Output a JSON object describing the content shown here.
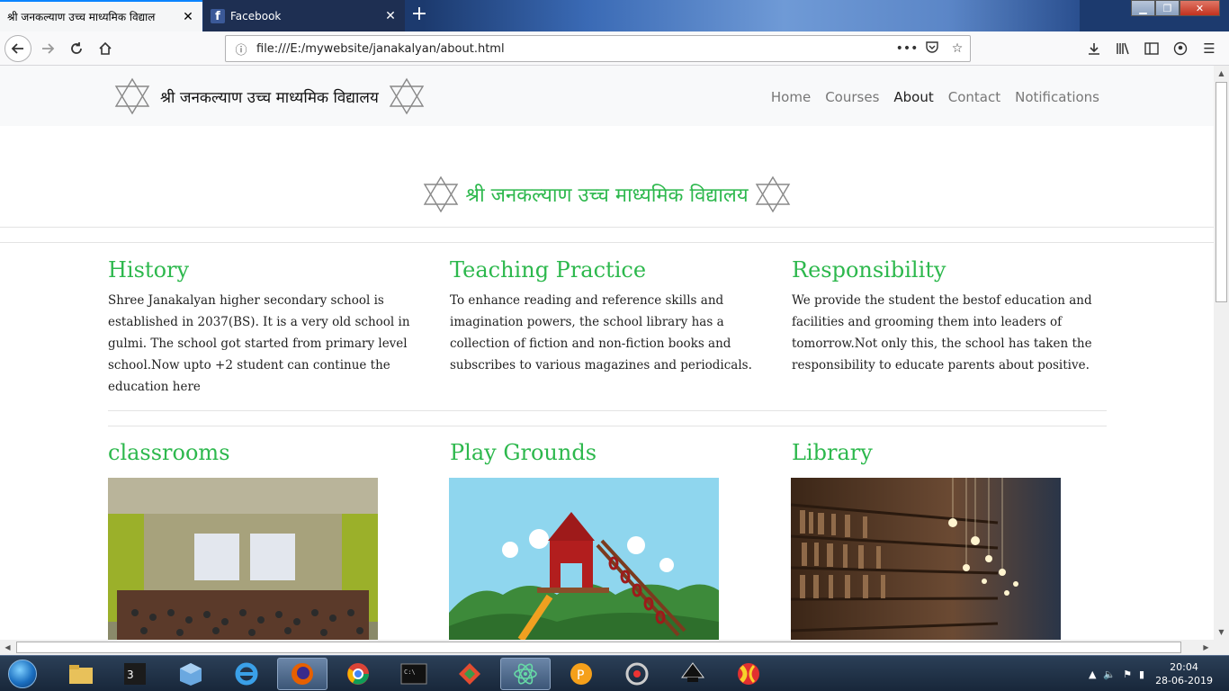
{
  "browser": {
    "tabs": [
      {
        "title": "श्री जनकल्याण उच्च माध्यमिक विद्याल",
        "active": true
      },
      {
        "title": "Facebook",
        "active": false
      }
    ],
    "url": "file:///E:/mywebsite/janakalyan/about.html"
  },
  "site": {
    "brand": "श्री जनकल्याण उच्च माध्यमिक विद्यालय",
    "nav": [
      "Home",
      "Courses",
      "About",
      "Contact",
      "Notifications"
    ],
    "active_nav": "About",
    "hero_title": "श्री जनकल्याण उच्च माध्यमिक विद्यालय",
    "sections": [
      {
        "title": "History",
        "text": "Shree Janakalyan higher secondary school is established in 2037(BS). It is a very old school in gulmi. The school got started from primary level school.Now upto +2 student can continue the education here"
      },
      {
        "title": "Teaching Practice",
        "text": "To enhance reading and reference skills and imagination powers, the school library has a collection of fiction and non-fiction books and subscribes to various magazines and periodicals."
      },
      {
        "title": "Responsibility",
        "text": "We provide the student the bestof education and facilities and grooming them into leaders of tomorrow.Not only this, the school has taken the responsibility to educate parents about positive."
      }
    ],
    "gallery": [
      {
        "title": "classrooms"
      },
      {
        "title": "Play Grounds"
      },
      {
        "title": "Library"
      }
    ]
  },
  "taskbar": {
    "time": "20:04",
    "date": "28-06-2019"
  },
  "colors": {
    "accent": "#2db84d",
    "nav_bg": "#f8f9fa"
  }
}
